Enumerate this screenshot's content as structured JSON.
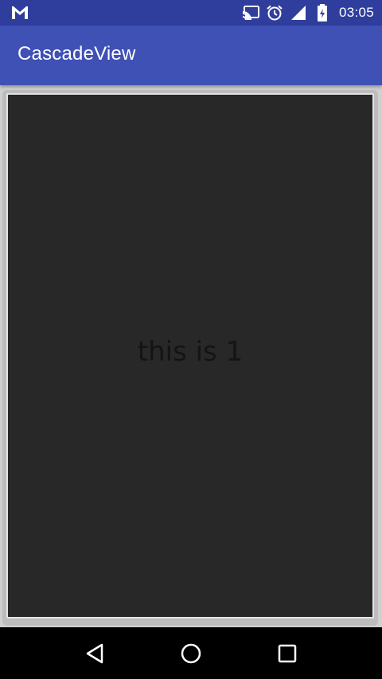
{
  "status_bar": {
    "time": "03:05",
    "icons": [
      "gmail-icon",
      "cast-icon",
      "alarm-icon",
      "signal-icon",
      "battery-icon"
    ]
  },
  "app_bar": {
    "title": "CascadeView"
  },
  "card": {
    "text": "this is 1"
  },
  "nav_bar": {
    "buttons": [
      "back-icon",
      "home-icon",
      "recents-icon"
    ]
  },
  "colors": {
    "status_bar": "#2f3e9d",
    "app_bar": "#3f51b5",
    "card_background": "#282829",
    "card_text": "#141414",
    "nav_bar": "#000000"
  }
}
